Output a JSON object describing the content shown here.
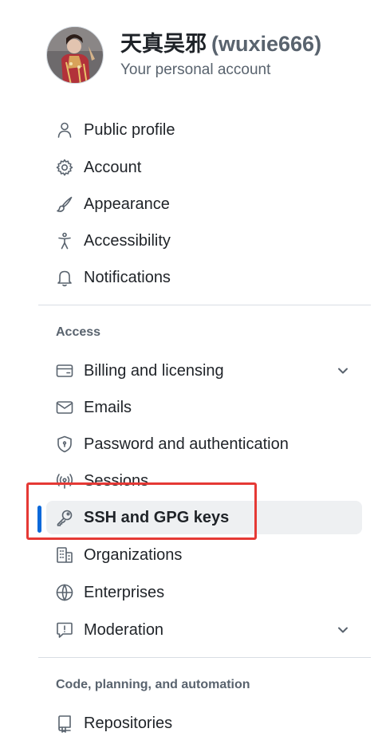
{
  "profile": {
    "display_name": "天真吴邪",
    "login": "(wuxie666)",
    "subtitle": "Your personal account"
  },
  "nav_top": [
    {
      "label": "Public profile",
      "icon": "person-icon"
    },
    {
      "label": "Account",
      "icon": "gear-icon"
    },
    {
      "label": "Appearance",
      "icon": "paintbrush-icon"
    },
    {
      "label": "Accessibility",
      "icon": "accessibility-icon"
    },
    {
      "label": "Notifications",
      "icon": "bell-icon"
    }
  ],
  "access": {
    "heading": "Access",
    "items": [
      {
        "label": "Billing and licensing",
        "icon": "credit-card-icon",
        "expandable": true
      },
      {
        "label": "Emails",
        "icon": "mail-icon"
      },
      {
        "label": "Password and authentication",
        "icon": "shield-lock-icon"
      },
      {
        "label": "Sessions",
        "icon": "broadcast-icon"
      },
      {
        "label": "SSH and GPG keys",
        "icon": "key-icon",
        "selected": true
      },
      {
        "label": "Organizations",
        "icon": "organization-icon"
      },
      {
        "label": "Enterprises",
        "icon": "globe-icon"
      },
      {
        "label": "Moderation",
        "icon": "report-icon",
        "expandable": true
      }
    ]
  },
  "code": {
    "heading": "Code, planning, and automation",
    "items": [
      {
        "label": "Repositories",
        "icon": "repo-icon"
      }
    ]
  },
  "colors": {
    "selected_indicator": "#0969da",
    "highlight_annotation": "#e53935"
  }
}
